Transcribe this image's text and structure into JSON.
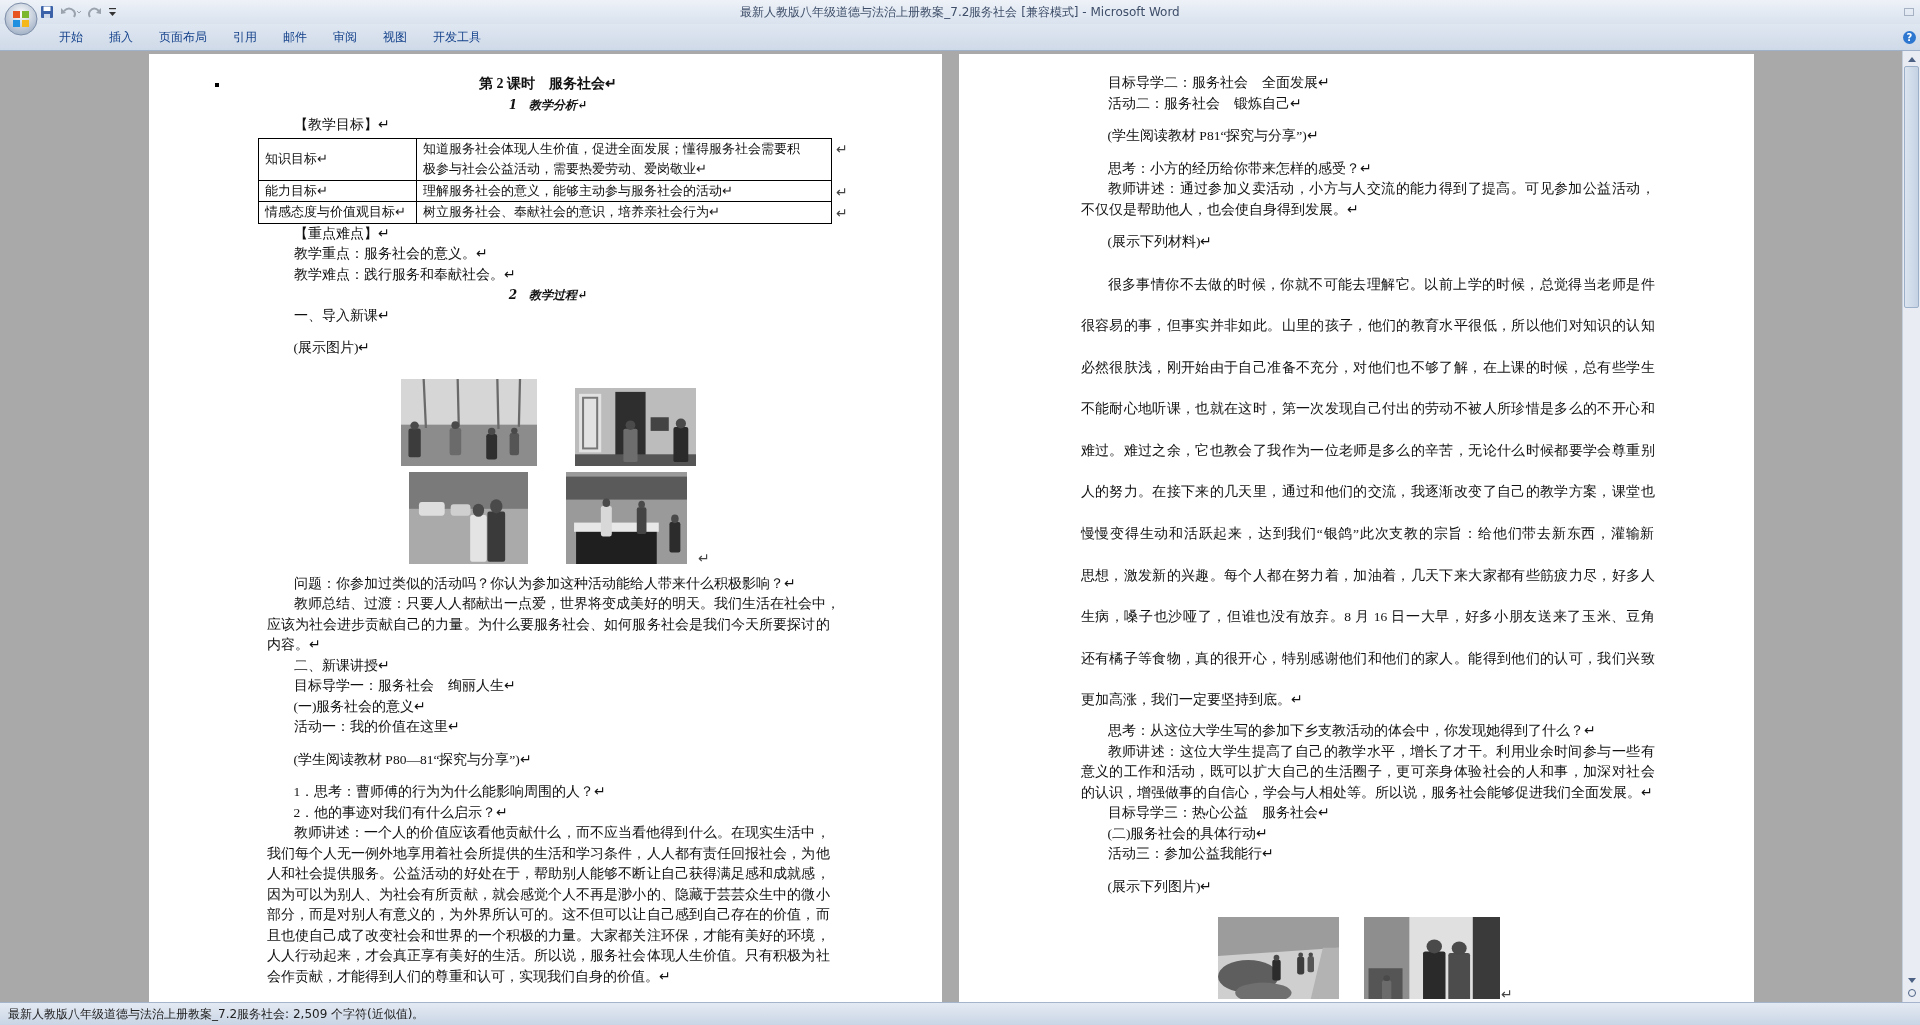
{
  "window": {
    "title": "最新人教版八年级道德与法治上册教案_7.2服务社会 [兼容模式] - Microsoft Word"
  },
  "ribbon": {
    "tabs": [
      {
        "label": "开始"
      },
      {
        "label": "插入"
      },
      {
        "label": "页面布局"
      },
      {
        "label": "引用"
      },
      {
        "label": "邮件"
      },
      {
        "label": "审阅"
      },
      {
        "label": "视图"
      },
      {
        "label": "开发工具"
      }
    ],
    "help": "?"
  },
  "pages": [
    {
      "blocks": [
        {
          "kind": "title",
          "text": "第 2 课时　服务社会↵",
          "anchor": true
        },
        {
          "kind": "section",
          "text": "1　教学分析↵"
        },
        {
          "kind": "para",
          "lines": [
            "【教学目标】↵"
          ]
        },
        {
          "kind": "table",
          "rows": [
            {
              "cells": [
                [
                  "知识目标↵"
                ],
                [
                  "知道服务社会体现人生价值，促进全面发展；懂得服务社会需要积",
                  "极参与社会公益活动，需要热爱劳动、爱岗敬业↵"
                ]
              ],
              "mark": "↵"
            },
            {
              "cells": [
                [
                  "能力目标↵"
                ],
                [
                  "理解服务社会的意义，能够主动参与服务社会的活动↵"
                ]
              ],
              "mark": "↵"
            },
            {
              "cells": [
                [
                  "情感态度与价值观目标↵"
                ],
                [
                  "树立服务社会、奉献社会的意识，培养亲社会行为↵"
                ]
              ],
              "mark": "↵"
            }
          ]
        },
        {
          "kind": "para",
          "lines": [
            "【重点难点】↵"
          ]
        },
        {
          "kind": "para",
          "lines": [
            "教学重点：服务社会的意义。↵"
          ]
        },
        {
          "kind": "para",
          "lines": [
            "教学难点：践行服务和奉献社会。↵"
          ]
        },
        {
          "kind": "section",
          "text": "2　教学过程↵"
        },
        {
          "kind": "para",
          "lines": [
            "一、导入新课↵"
          ]
        },
        {
          "kind": "gap-para",
          "lines": [
            "(展示图片)↵"
          ]
        },
        {
          "kind": "photos",
          "rows": [
            {
              "pictures": [
                {
                  "kind": "picture"
                },
                {
                  "kind": "picture"
                }
              ]
            },
            {
              "pictures": [
                {
                  "kind": "picture"
                },
                {
                  "kind": "picture"
                }
              ],
              "mark": "↵"
            }
          ]
        },
        {
          "kind": "para",
          "lines": [
            "问题：你参加过类似的活动吗？你认为参加这种活动能给人带来什么积极影响？↵"
          ]
        },
        {
          "kind": "para",
          "lines": [
            "教师总结、过渡：只要人人都献出一点爱，世界将变成美好的明天。我们生活在社会中，",
            "应该为社会进步贡献自己的力量。为什么要服务社会、如何服务社会是我们今天所要探讨的",
            "内容。↵"
          ]
        },
        {
          "kind": "para",
          "lines": [
            "二、新课讲授↵"
          ]
        },
        {
          "kind": "para",
          "lines": [
            "目标导学一：服务社会　绚丽人生↵"
          ]
        },
        {
          "kind": "para",
          "lines": [
            "(一)服务社会的意义↵"
          ]
        },
        {
          "kind": "para",
          "lines": [
            "活动一：我的价值在这里↵"
          ]
        },
        {
          "kind": "gap-para",
          "lines": [
            "(学生阅读教材 P80—81“探究与分享”)↵"
          ]
        },
        {
          "kind": "gap-para",
          "lines": [
            "1．思考：曹师傅的行为为什么能影响周围的人？↵"
          ]
        },
        {
          "kind": "para",
          "lines": [
            "2．他的事迹对我们有什么启示？↵"
          ]
        },
        {
          "kind": "para",
          "lines": [
            "教师讲述：一个人的价值应该看他贡献什么，而不应当看他得到什么。在现实生活中，",
            "我们每个人无一例外地享用着社会所提供的生活和学习条件，人人都有责任回报社会，为他",
            "人和社会提供服务。公益活动的好处在于，帮助别人能够不断让自己获得满足感和成就感，",
            "因为可以为别人、为社会有所贡献，就会感觉个人不再是渺小的、隐藏于芸芸众生中的微小",
            "部分，而是对别人有意义的，为外界所认可的。这不但可以让自己感到自己存在的价值，而",
            "且也使自己成了改变社会和世界的一个积极的力量。大家都关注环保，才能有美好的环境，",
            "人人行动起来，才会真正享有美好的生活。所以说，服务社会体现人生价值。只有积极为社",
            "会作贡献，才能得到人们的尊重和认可，实现我们自身的价值。↵"
          ]
        }
      ]
    },
    {
      "blocks": [
        {
          "kind": "para",
          "lines": [
            "目标导学二：服务社会　全面发展↵"
          ]
        },
        {
          "kind": "para",
          "lines": [
            "活动二：服务社会　锻炼自己↵"
          ]
        },
        {
          "kind": "gap-para",
          "lines": [
            "(学生阅读教材 P81“探究与分享”)↵"
          ]
        },
        {
          "kind": "gap-para",
          "lines": [
            "思考：小方的经历给你带来怎样的感受？↵"
          ]
        },
        {
          "kind": "para",
          "lines": [
            "教师讲述：通过参加义卖活动，小方与人交流的能力得到了提高。可见参加公益活动，",
            "不仅仅是帮助他人，也会使自身得到发展。↵"
          ]
        },
        {
          "kind": "gap-para",
          "lines": [
            "(展示下列材料)↵"
          ]
        },
        {
          "kind": "loose-para",
          "lines": [
            "很多事情你不去做的时候，你就不可能去理解它。以前上学的时候，总觉得当老师是件",
            "很容易的事，但事实并非如此。山里的孩子，他们的教育水平很低，所以他们对知识的认知",
            "必然很肤浅，刚开始由于自己准备不充分，对他们也不够了解，在上课的时候，总有些学生",
            "不能耐心地听课，也就在这时，第一次发现自己付出的劳动不被人所珍惜是多么的不开心和",
            "难过。难过之余，它也教会了我作为一位老师是多么的辛苦，无论什么时候都要学会尊重别",
            "人的努力。在接下来的几天里，通过和他们的交流，我逐渐改变了自己的教学方案，课堂也",
            "慢慢变得生动和活跃起来，达到我们“银鸽”此次支教的宗旨：给他们带去新东西，灌输新",
            "思想，激发新的兴趣。每个人都在努力着，加油着，几天下来大家都有些筋疲力尽，好多人",
            "生病，嗓子也沙哑了，但谁也没有放弃。8 月 16 日一大早，好多小朋友送来了玉米、豆角",
            "还有橘子等食物，真的很开心，特别感谢他们和他们的家人。能得到他们的认可，我们兴致",
            "更加高涨，我们一定要坚持到底。↵"
          ]
        },
        {
          "kind": "para",
          "lines": [
            "思考：从这位大学生写的参加下乡支教活动的体会中，你发现她得到了什么？↵"
          ]
        },
        {
          "kind": "para",
          "lines": [
            "教师讲述：这位大学生提高了自己的教学水平，增长了才干。利用业余时间参与一些有",
            "意义的工作和活动，既可以扩大自己的生活圈子，更可亲身体验社会的人和事，加深对社会",
            "的认识，增强做事的自信心，学会与人相处等。所以说，服务社会能够促进我们全面发展。↵"
          ]
        },
        {
          "kind": "para",
          "lines": [
            "目标导学三：热心公益　服务社会↵"
          ]
        },
        {
          "kind": "para",
          "lines": [
            "(二)服务社会的具体行动↵"
          ]
        },
        {
          "kind": "para",
          "lines": [
            "活动三：参加公益我能行↵"
          ]
        },
        {
          "kind": "gap-para",
          "lines": [
            "(展示下列图片)↵"
          ]
        },
        {
          "kind": "photos",
          "rows": [
            {
              "pictures": [
                {
                  "kind": "picture"
                },
                {
                  "kind": "picture"
                }
              ],
              "mark": "↵"
            }
          ]
        }
      ]
    }
  ],
  "status_bar": {
    "text": "最新人教版八年级道德与法治上册教案_7.2服务社会: 2,509 个字符(近似值)。"
  }
}
